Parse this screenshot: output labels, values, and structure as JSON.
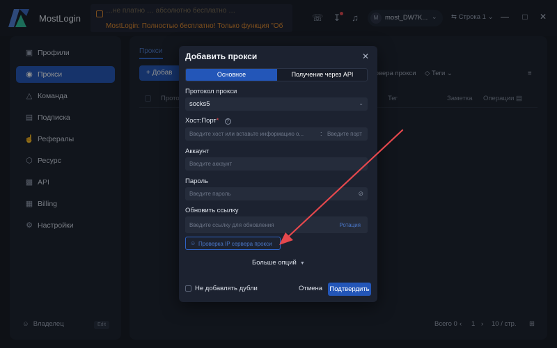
{
  "app": {
    "name": "MostLogin",
    "notice_line1": "…не платно … абсолютно бесплатно …",
    "notice_line2": "MostLogin: Полностью бесплатно! Только функция \"Об",
    "user": "most_DW7K...",
    "user_avatar": "M",
    "row_selector": "Строка 1",
    "accent": "#2356b8",
    "warning": "#e38a2c"
  },
  "sidebar": {
    "items": [
      {
        "label": "Профили",
        "icon": "profile-icon"
      },
      {
        "label": "Прокси",
        "icon": "proxy-icon",
        "active": true
      },
      {
        "label": "Команда",
        "icon": "team-icon"
      },
      {
        "label": "Подписка",
        "icon": "subscription-icon"
      },
      {
        "label": "Рефералы",
        "icon": "referral-icon"
      },
      {
        "label": "Ресурс",
        "icon": "resource-icon"
      },
      {
        "label": "API",
        "icon": "api-icon"
      },
      {
        "label": "Billing",
        "icon": "billing-icon"
      },
      {
        "label": "Настройки",
        "icon": "settings-icon"
      }
    ],
    "owner": "Владелец",
    "edit": "Edit"
  },
  "main": {
    "tab": "Прокси",
    "add_button": "Добав",
    "check_servers": "…ервера прокси",
    "tags": "Теги",
    "columns": {
      "protocol": "Проток",
      "tag": "Тег",
      "note": "Заметка",
      "ops": "Операции"
    },
    "total": "Всего 0",
    "page": "1",
    "per_page": "10 / стр."
  },
  "modal": {
    "title": "Добавить прокси",
    "tab_basic": "Основное",
    "tab_api": "Получение через API",
    "protocol_label": "Протокол прокси",
    "protocol_value": "socks5",
    "hostport_label": "Хост:Порт",
    "host_placeholder": "Введите хост или вставьте информацию о...",
    "port_placeholder": "Введите порт",
    "account_label": "Аккаунт",
    "account_placeholder": "Введите аккаунт",
    "password_label": "Пароль",
    "password_placeholder": "Введите пароль",
    "refresh_label": "Обновить ссылку",
    "refresh_placeholder": "Введите ссылку для обновления",
    "rotation": "Ротация",
    "check_ip": "Проверка IP сервера прокси",
    "more_options": "Больше опций",
    "no_duplicates": "Не добавлять дубли",
    "cancel": "Отмена",
    "confirm": "Подтвердить"
  }
}
